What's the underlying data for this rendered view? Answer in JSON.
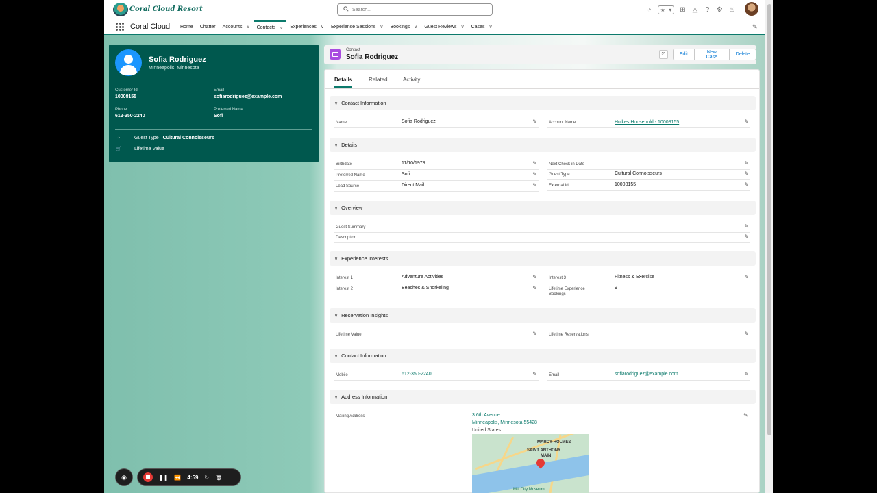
{
  "app": {
    "logo_text": "Coral Cloud Resort",
    "name": "Coral Cloud"
  },
  "search": {
    "placeholder": "Search..."
  },
  "nav": {
    "items": [
      {
        "label": "Home",
        "dropdown": false
      },
      {
        "label": "Chatter",
        "dropdown": false
      },
      {
        "label": "Accounts",
        "dropdown": true
      },
      {
        "label": "Contacts",
        "dropdown": true,
        "active": true
      },
      {
        "label": "Experiences",
        "dropdown": true
      },
      {
        "label": "Experience Sessions",
        "dropdown": true
      },
      {
        "label": "Bookings",
        "dropdown": true
      },
      {
        "label": "Guest Reviews",
        "dropdown": true
      },
      {
        "label": "Cases",
        "dropdown": true
      }
    ]
  },
  "highlights": {
    "name": "Sofia Rodriguez",
    "location": "Minneapolis, Minnesota",
    "customer_id_label": "Customer Id",
    "customer_id": "10008155",
    "email_label": "Email",
    "email": "sofiarodriguez@example.com",
    "phone_label": "Phone",
    "phone": "612-350-2240",
    "preferred_name_label": "Preferred Name",
    "preferred_name": "Sofi",
    "guest_type_label": "Guest Type",
    "guest_type": "Cultural Connoisseurs",
    "lifetime_value_label": "Lifetime Value"
  },
  "record": {
    "type": "Contact",
    "title": "Sofia Rodriguez",
    "buttons": {
      "edit": "Edit",
      "new_case": "New Case",
      "delete": "Delete"
    }
  },
  "tabs": [
    "Details",
    "Related",
    "Activity"
  ],
  "sections": {
    "contact_info": "Contact Information",
    "details": "Details",
    "overview": "Overview",
    "interests": "Experience Interests",
    "reservation": "Reservation Insights",
    "contact_info2": "Contact Information",
    "address": "Address Information"
  },
  "fields": {
    "name": {
      "label": "Name",
      "value": "Sofia Rodriguez"
    },
    "account_name": {
      "label": "Account Name",
      "value": "Hulkes Household - 10008155"
    },
    "birthdate": {
      "label": "Birthdate",
      "value": "11/10/1978"
    },
    "next_checkin": {
      "label": "Next Check-in Date",
      "value": ""
    },
    "preferred_name": {
      "label": "Preferred Name",
      "value": "Sofi"
    },
    "guest_type": {
      "label": "Guest Type",
      "value": "Cultural Connoisseurs"
    },
    "lead_source": {
      "label": "Lead Source",
      "value": "Direct Mail"
    },
    "external_id": {
      "label": "External Id",
      "value": "10008155"
    },
    "guest_summary": {
      "label": "Guest Summary",
      "value": ""
    },
    "description": {
      "label": "Description",
      "value": ""
    },
    "interest1": {
      "label": "Interest 1",
      "value": "Adventure Activities"
    },
    "interest3": {
      "label": "Interest 3",
      "value": "Fitness & Exercise"
    },
    "interest2": {
      "label": "Interest 2",
      "value": "Beaches & Snorkeling"
    },
    "lifetime_bookings": {
      "label": "Lifetime Experience Bookings",
      "value": "9"
    },
    "lifetime_value": {
      "label": "Lifetime Value",
      "value": ""
    },
    "lifetime_reservations": {
      "label": "Lifetime Reservations",
      "value": ""
    },
    "mobile": {
      "label": "Mobile",
      "value": "612-350-2240"
    },
    "email": {
      "label": "Email",
      "value": "sofiarodriguez@example.com"
    }
  },
  "address": {
    "label": "Mailing Address",
    "line1": "3 6th Avenue",
    "line2": "Minneapolis, Minnesota 55428",
    "line3": "United States",
    "map_labels": [
      "MARCY-HOLMES",
      "SAINT ANTHONY",
      "MAIN",
      "Mill City Museum"
    ]
  },
  "recorder": {
    "time": "4:59"
  },
  "colors": {
    "brand": "#0c7a6c",
    "highlights_bg": "#00584e",
    "contact_icon": "#a94ce0"
  }
}
